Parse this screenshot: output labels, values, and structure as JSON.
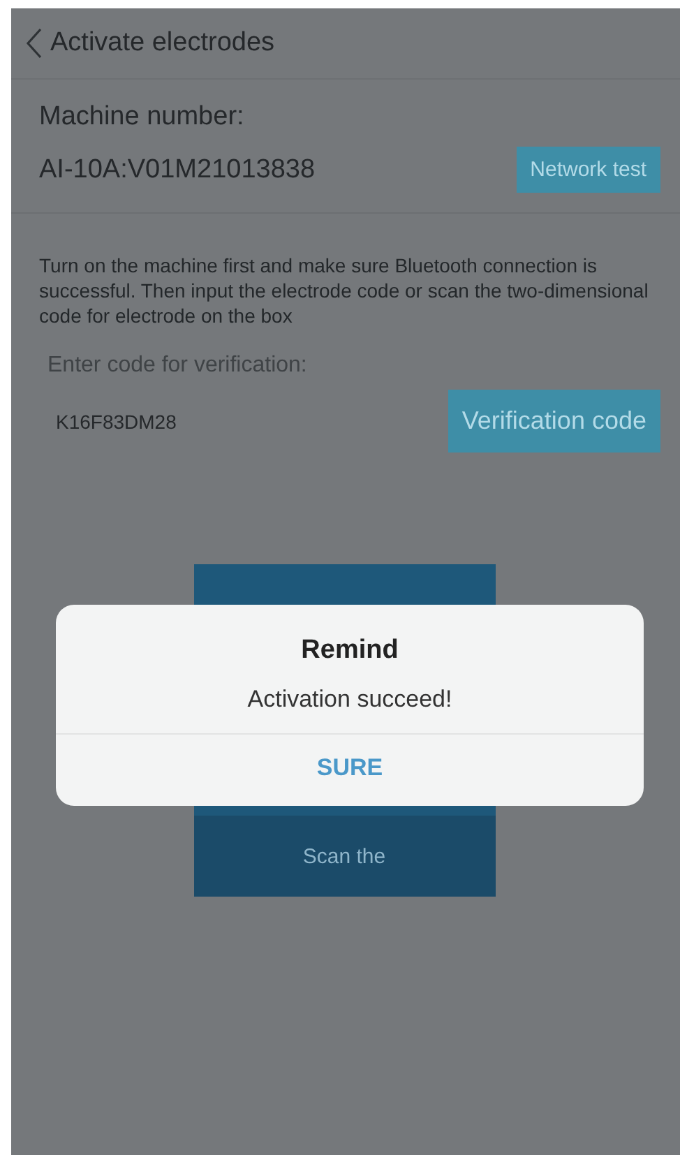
{
  "header": {
    "title": "Activate electrodes"
  },
  "machine": {
    "label": "Machine number:",
    "value": "AI-10A:V01M21013838",
    "button": "Network test"
  },
  "instructions": "Turn on the machine first and make sure Bluetooth connection is successful. Then input the electrode code or scan the two-dimensional code for electrode on the box",
  "verification": {
    "label": "Enter code for verification:",
    "value": "K16F83DM28",
    "button": "Verification code"
  },
  "scan_button": {
    "label": "Scan the"
  },
  "dialog": {
    "title": "Remind",
    "message": "Activation succeed!",
    "button": "SURE"
  }
}
